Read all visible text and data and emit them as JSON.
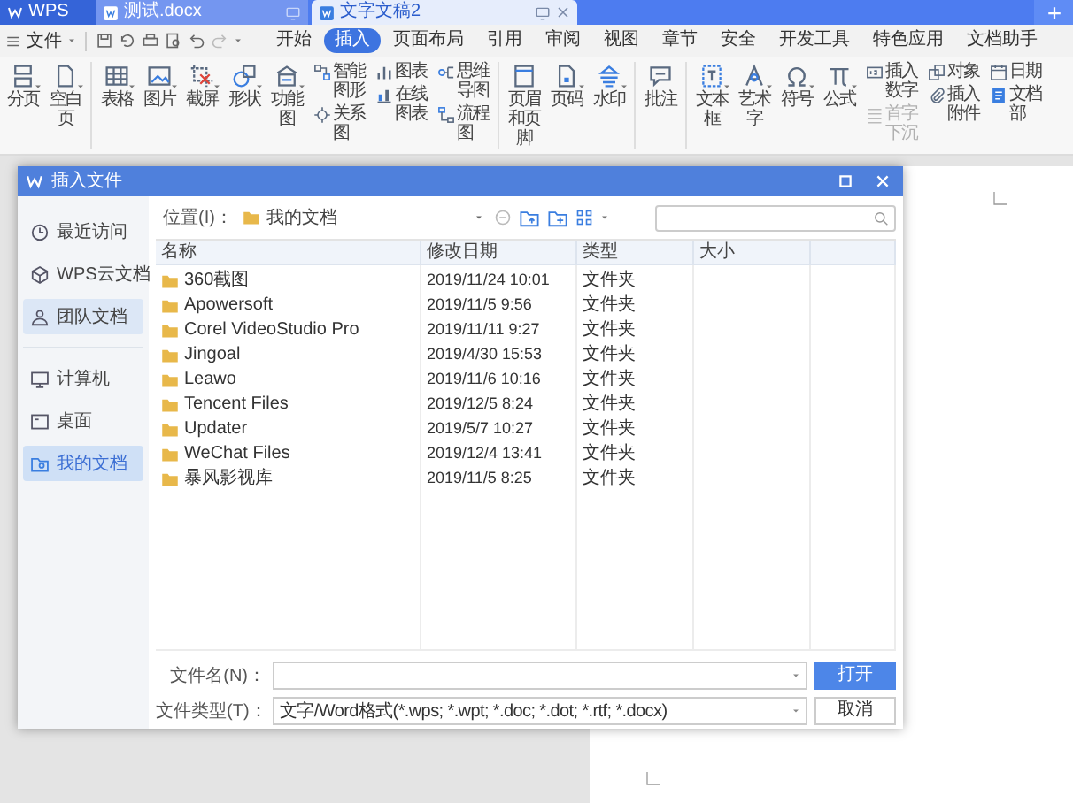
{
  "title_bar": {
    "tabs": [
      {
        "label": "WPS",
        "kind": "app",
        "selected": false
      },
      {
        "label": "测试.docx",
        "kind": "doc",
        "selected": false
      },
      {
        "label": "文字文稿2",
        "kind": "doc",
        "selected": true
      }
    ]
  },
  "menu_bar": {
    "file_menu": "文件",
    "tabs": [
      {
        "label": "开始",
        "selected": false
      },
      {
        "label": "插入",
        "selected": true
      },
      {
        "label": "页面布局",
        "selected": false
      },
      {
        "label": "引用",
        "selected": false
      },
      {
        "label": "审阅",
        "selected": false
      },
      {
        "label": "视图",
        "selected": false
      },
      {
        "label": "章节",
        "selected": false
      },
      {
        "label": "安全",
        "selected": false
      },
      {
        "label": "开发工具",
        "selected": false
      },
      {
        "label": "特色应用",
        "selected": false
      },
      {
        "label": "文档助手",
        "selected": false
      }
    ]
  },
  "ribbon": {
    "groups": [
      {
        "items": [
          {
            "kind": "large",
            "label": "分页",
            "dropdown": true
          },
          {
            "kind": "large",
            "label": "空白页",
            "dropdown": true
          }
        ]
      },
      {
        "items": [
          {
            "kind": "large",
            "label": "表格",
            "dropdown": true
          },
          {
            "kind": "large",
            "label": "图片",
            "dropdown": true
          },
          {
            "kind": "large",
            "label": "截屏",
            "dropdown": true
          },
          {
            "kind": "large",
            "label": "形状",
            "dropdown": true
          },
          {
            "kind": "large",
            "label": "功能图",
            "dropdown": true
          },
          {
            "kind": "small",
            "label": "智能图形",
            "disabled": false
          },
          {
            "kind": "small",
            "label": "关系图",
            "disabled": false
          },
          {
            "kind": "small",
            "label": "图表",
            "disabled": false
          },
          {
            "kind": "small",
            "label": "在线图表",
            "disabled": false
          },
          {
            "kind": "small",
            "label": "思维导图",
            "disabled": false
          },
          {
            "kind": "small",
            "label": "流程图",
            "disabled": false
          }
        ]
      },
      {
        "items": [
          {
            "kind": "large",
            "label": "页眉和页脚",
            "dropdown": false
          },
          {
            "kind": "large",
            "label": "页码",
            "dropdown": true
          },
          {
            "kind": "large",
            "label": "水印",
            "dropdown": true
          }
        ]
      },
      {
        "items": [
          {
            "kind": "large",
            "label": "批注",
            "dropdown": false
          }
        ]
      },
      {
        "items": [
          {
            "kind": "large",
            "label": "文本框",
            "dropdown": true
          },
          {
            "kind": "large",
            "label": "艺术字",
            "dropdown": true
          },
          {
            "kind": "large",
            "label": "符号",
            "dropdown": true
          },
          {
            "kind": "large",
            "label": "公式",
            "dropdown": true
          },
          {
            "kind": "small",
            "label": "插入数字",
            "disabled": false
          },
          {
            "kind": "small",
            "label": "首字下沉",
            "disabled": true
          },
          {
            "kind": "small",
            "label": "对象",
            "disabled": false
          },
          {
            "kind": "small",
            "label": "插入附件",
            "disabled": false
          },
          {
            "kind": "small",
            "label": "日期",
            "disabled": false
          },
          {
            "kind": "small",
            "label": "文档部",
            "disabled": false
          }
        ]
      }
    ]
  },
  "dialog": {
    "title": "插入文件",
    "sidebar": [
      {
        "label": "最近访问",
        "selected": false,
        "hover": false
      },
      {
        "label": "WPS云文档",
        "selected": false,
        "hover": false
      },
      {
        "label": "团队文档",
        "selected": false,
        "hover": true
      },
      {
        "label": "计算机",
        "selected": false,
        "hover": false
      },
      {
        "label": "桌面",
        "selected": false,
        "hover": false
      },
      {
        "label": "我的文档",
        "selected": true,
        "hover": false
      }
    ],
    "location": {
      "label": "位置(I)：",
      "value": "我的文档"
    },
    "table": {
      "columns": [
        "名称",
        "修改日期",
        "类型",
        "大小"
      ],
      "rows": [
        [
          "360截图",
          "2019/11/24 10:01",
          "文件夹"
        ],
        [
          "Apowersoft",
          "2019/11/5 9:56",
          "文件夹"
        ],
        [
          "Corel VideoStudio Pro",
          "2019/11/11 9:27",
          "文件夹"
        ],
        [
          "Jingoal",
          "2019/4/30 15:53",
          "文件夹"
        ],
        [
          "Leawo",
          "2019/11/6 10:16",
          "文件夹"
        ],
        [
          "Tencent Files",
          "2019/12/5 8:24",
          "文件夹"
        ],
        [
          "Updater",
          "2019/5/7 10:27",
          "文件夹"
        ],
        [
          "WeChat Files",
          "2019/12/4 13:41",
          "文件夹"
        ],
        [
          "暴风影视库",
          "2019/11/5 8:25",
          "文件夹"
        ]
      ]
    },
    "file_name": {
      "label": "文件名(N)："
    },
    "file_type": {
      "label": "文件类型(T)：",
      "value": "文字/Word格式(*.wps; *.wpt; *.doc; *.dot; *.rtf; *.docx)"
    },
    "buttons": [
      {
        "label": "打开",
        "kind": "primary"
      },
      {
        "label": "取消",
        "kind": "secondary"
      }
    ]
  }
}
